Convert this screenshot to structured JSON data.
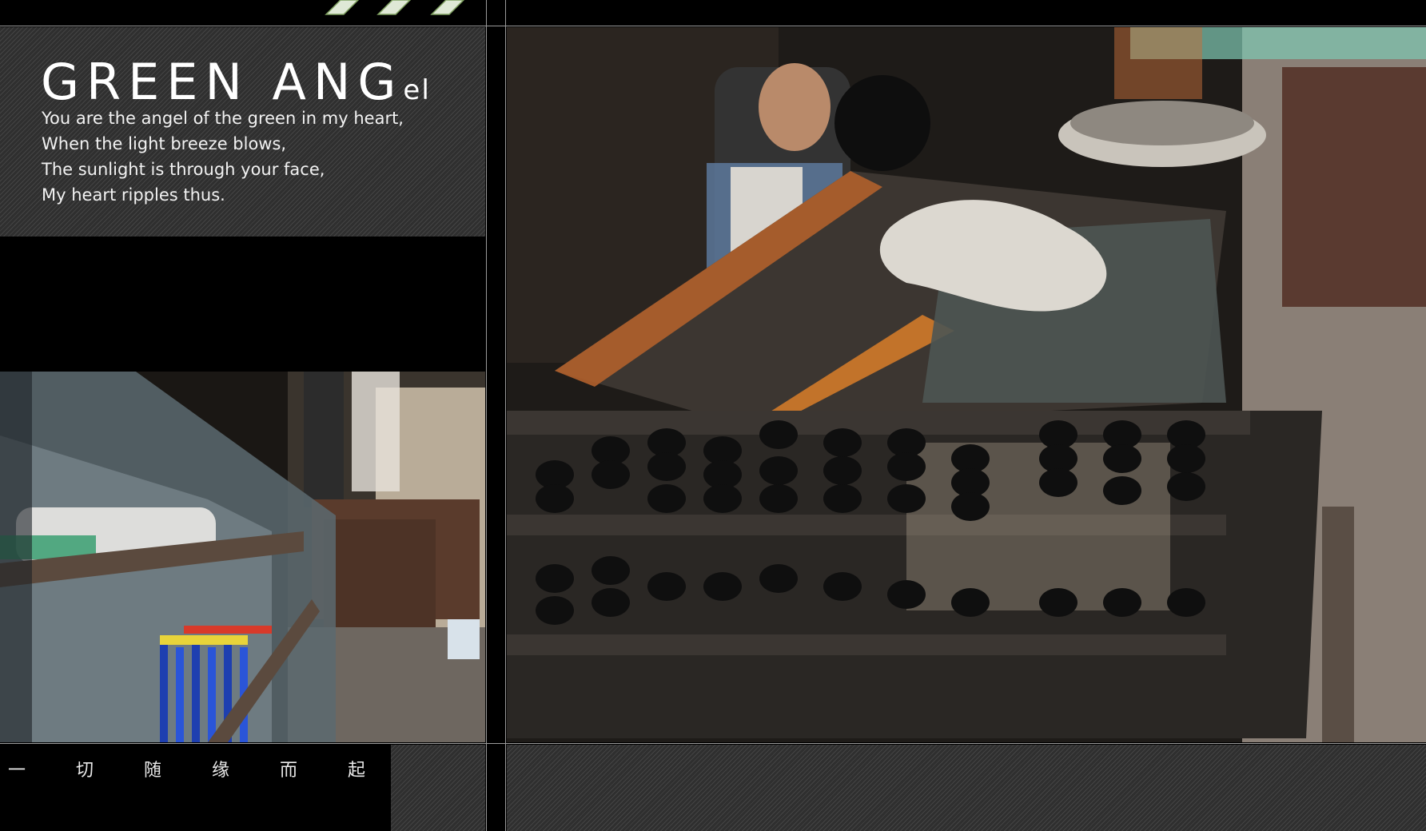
{
  "title": {
    "main": "GREEN ANG",
    "suffix": "el"
  },
  "poem": [
    "You are the angel of the green in my heart,",
    "When the light breeze blows,",
    "The sunlight is through your face,",
    "My heart ripples thus."
  ],
  "caption_chinese": "一 切 随 缘 而 起 . . . . . . ."
}
